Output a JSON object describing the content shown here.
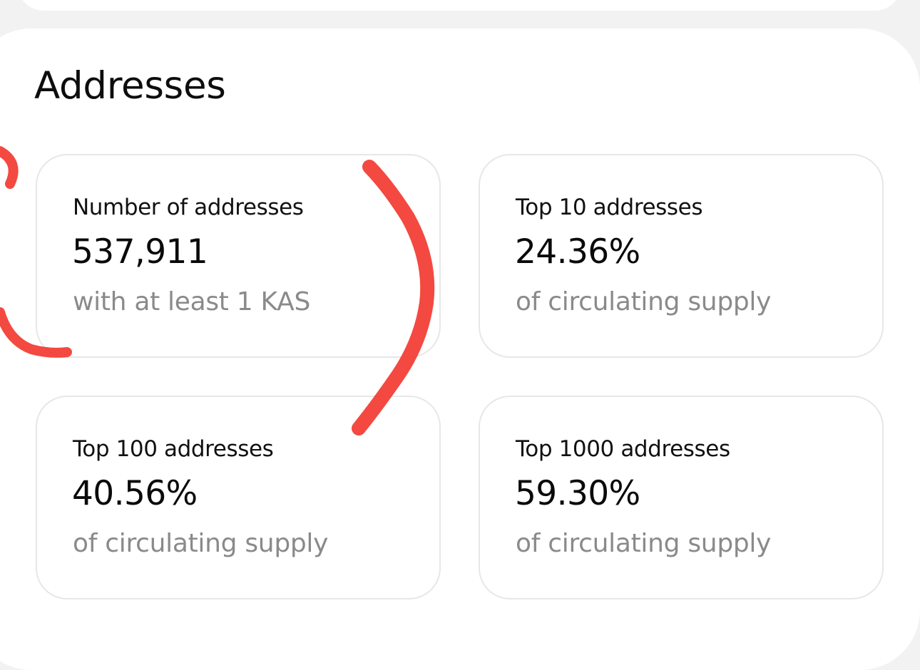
{
  "section": {
    "title": "Addresses"
  },
  "cards": [
    {
      "label": "Number of addresses",
      "value": "537,911",
      "note": "with at least 1 KAS"
    },
    {
      "label": "Top 10 addresses",
      "value": "24.36%",
      "note": "of circulating supply"
    },
    {
      "label": "Top 100 addresses",
      "value": "40.56%",
      "note": "of circulating supply"
    },
    {
      "label": "Top 1000 addresses",
      "value": "59.30%",
      "note": "of circulating supply"
    }
  ],
  "annotation": {
    "color": "#f2352c"
  }
}
